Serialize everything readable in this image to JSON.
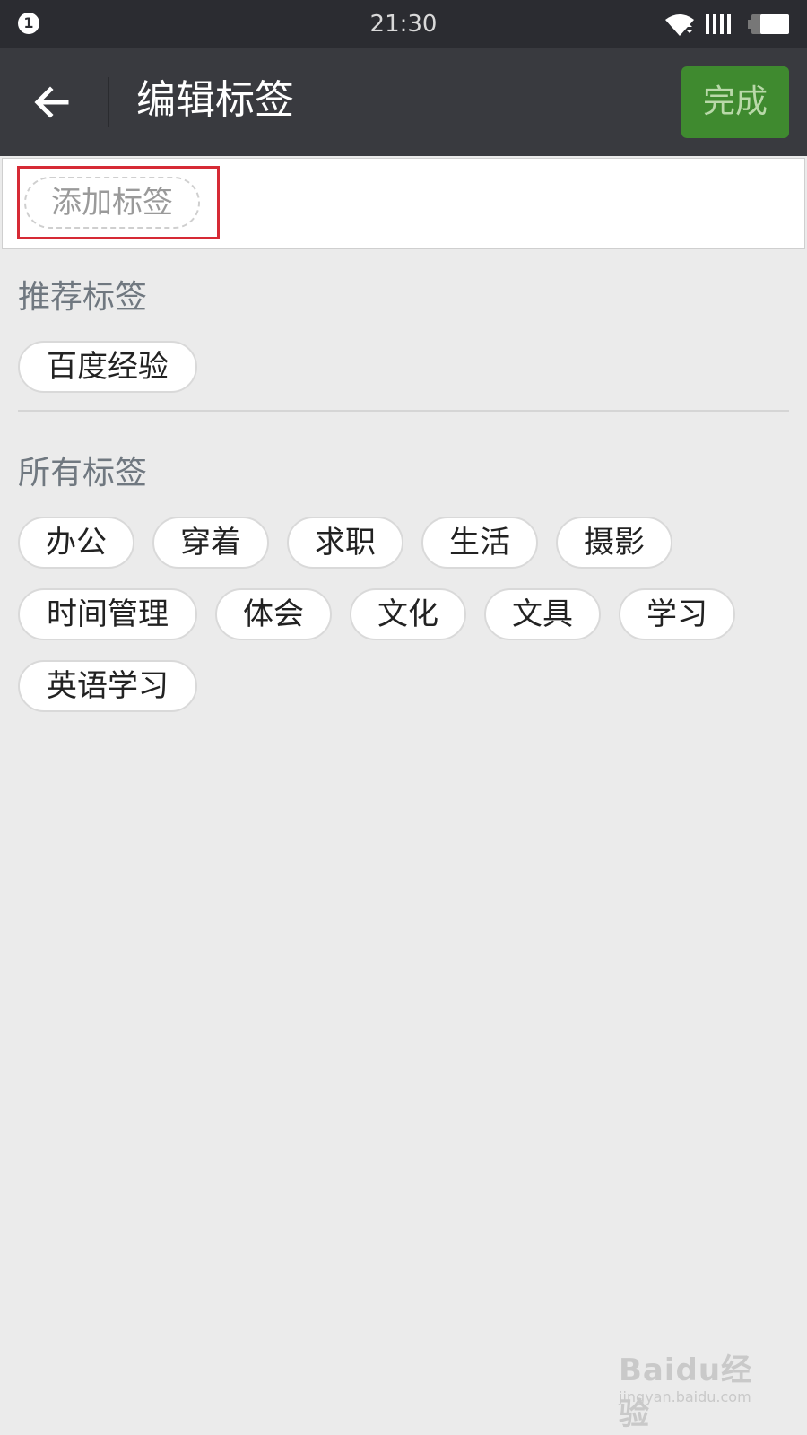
{
  "status_bar": {
    "notification_badge": "1",
    "time": "21:30",
    "icons": [
      "wifi-icon",
      "signal-icon",
      "battery-icon"
    ]
  },
  "header": {
    "back_icon": "arrow-left-icon",
    "title": "编辑标签",
    "done_label": "完成"
  },
  "tag_input": {
    "placeholder": "添加标签"
  },
  "recommended": {
    "title": "推荐标签",
    "tags": [
      "百度经验"
    ]
  },
  "all": {
    "title": "所有标签",
    "tags": [
      "办公",
      "穿着",
      "求职",
      "生活",
      "摄影",
      "时间管理",
      "体会",
      "文化",
      "文具",
      "学习",
      "英语学习"
    ]
  },
  "watermark": {
    "logo_text": "Baidu经验",
    "url_text": "jingyan.baidu.com"
  },
  "colors": {
    "status_bar_bg": "#2b2c31",
    "appbar_bg": "#393a3f",
    "done_button_bg": "#3f8a2f",
    "highlight": "#d62a35",
    "page_bg": "#ebebeb"
  }
}
